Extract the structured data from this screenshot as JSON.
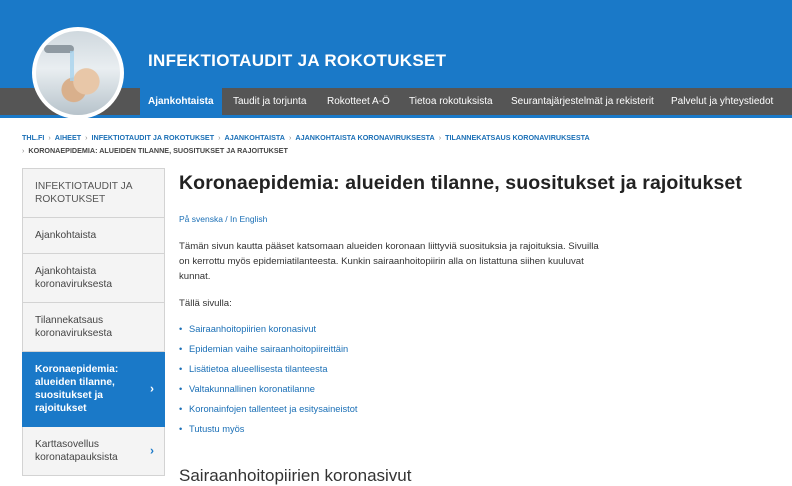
{
  "header": {
    "site_title": "INFEKTIOTAUDIT JA ROKOTUKSET",
    "nav": [
      {
        "label": "Ajankohtaista",
        "active": true
      },
      {
        "label": "Taudit ja torjunta"
      },
      {
        "label": "Rokotteet A-Ö"
      },
      {
        "label": "Tietoa rokotuksista"
      },
      {
        "label": "Seurantajärjestelmät ja rekisterit"
      },
      {
        "label": "Palvelut ja yhteystiedot"
      }
    ]
  },
  "breadcrumb": {
    "items": [
      "THL.FI",
      "AIHEET",
      "INFEKTIOTAUDIT JA ROKOTUKSET",
      "AJANKOHTAISTA",
      "AJANKOHTAISTA KORONAVIRUKSESTA",
      "TILANNEKATSAUS KORONAVIRUKSESTA"
    ],
    "current": "KORONAEPIDEMIA: ALUEIDEN TILANNE, SUOSITUKSET JA RAJOITUKSET",
    "separator": "›"
  },
  "sidebar": {
    "items": [
      {
        "label": "INFEKTIOTAUDIT JA ROKOTUKSET"
      },
      {
        "label": "Ajankohtaista"
      },
      {
        "label": "Ajankohtaista koronaviruksesta"
      },
      {
        "label": "Tilannekatsaus koronaviruksesta"
      },
      {
        "label": "Koronaepidemia: alueiden tilanne, suositukset ja rajoitukset",
        "chev": "›"
      },
      {
        "label": "Karttasovellus koronatapauksista",
        "chev": "›"
      }
    ]
  },
  "main": {
    "title": "Koronaepidemia: alueiden tilanne, suositukset ja rajoitukset",
    "lang_links": "På svenska / In English",
    "intro": "Tämän sivun kautta pääset katsomaan alueiden koronaan liittyviä suosituksia ja rajoituksia. Sivuilla on kerrottu myös epidemiatilanteesta.  Kunkin sairaanhoitopiirin alla on listattuna siihen kuuluvat kunnat.",
    "on_this_page": "Tällä sivulla:",
    "links": [
      "Sairaanhoitopiirien koronasivut",
      "Epidemian vaihe sairaanhoitopiireittäin",
      "Lisätietoa alueellisesta tilanteesta",
      "Valtakunnallinen koronatilanne",
      "Koronainfojen tallenteet ja esitysaineistot",
      "Tutustu myös"
    ],
    "next_heading": "Sairaanhoitopiirien koronasivut"
  },
  "colors": {
    "brand_blue": "#1a79c8",
    "nav_gray": "#555555",
    "link": "#1a6fb6"
  }
}
